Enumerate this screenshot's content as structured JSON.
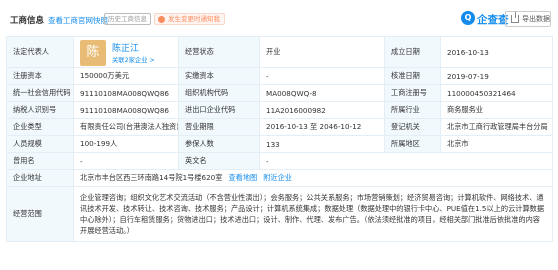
{
  "header": {
    "title": "工商信息",
    "official_link": "查看工商官网快照",
    "history_tag": "历史工商信息",
    "warning_tag": "发生变更时通知我",
    "brand": "企查查",
    "export_label": "导出数据",
    "colors": {
      "accent": "#128bed",
      "label_bg": "#f2f9fc",
      "avatar": "#e9bc75"
    }
  },
  "legal_rep": {
    "label": "法定代表人",
    "avatar_char": "陈",
    "name": "陈正江",
    "related": "关联2家企业 >"
  },
  "rows": {
    "status_label": "经营状态",
    "status_value": "开业",
    "est_label": "成立日期",
    "est_value": "2016-10-13",
    "capital_label": "注册资本",
    "capital_value": "150000万美元",
    "paid_label": "实缴资本",
    "paid_value": "-",
    "approve_label": "核准日期",
    "approve_value": "2019-07-19",
    "credit_label": "统一社会信用代码",
    "credit_value": "91110108MA008QWQ86",
    "org_label": "组织机构代码",
    "org_value": "MA008QWQ-8",
    "reg_label": "工商注册号",
    "reg_value": "110000450321464",
    "tax_label": "纳税人识别号",
    "tax_value": "91110108MA008QWQ86",
    "ie_label": "进出口企业代码",
    "ie_value": "11A2016000982",
    "industry_label": "所属行业",
    "industry_value": "商务服务业",
    "type_label": "企业类型",
    "type_value": "有限责任公司(台港澳法人独资)",
    "term_label": "营业期限",
    "term_value": "2016-10-13 至 2046-10-12",
    "authority_label": "登记机关",
    "authority_value": "北京市工商行政管理局丰台分局",
    "staff_label": "人员规模",
    "staff_value": "100-199人",
    "insured_label": "参保人数",
    "insured_value": "133",
    "region_label": "所属地区",
    "region_value": "北京市",
    "former_label": "曾用名",
    "former_value": "-",
    "en_label": "英文名",
    "en_value": "-",
    "address_label": "企业地址",
    "address_value": "北京市丰台区西三环南路14号院1号楼620室",
    "map_link": "查看地图",
    "nearby_link": "附近企业",
    "scope_label": "经营范围",
    "scope_value": "企业管理咨询；组织文化艺术交流活动（不含营业性演出）；会务服务；公共关系服务；市场营销策划；经济贸易咨询；计算机软件、网络技术、通讯技术开发、技术转让、技术咨询、技术服务；产品设计；计算机系统集成；数据处理（数据处理中的银行卡中心、PUE值在1.5以上的云计算数据中心除外）；自行车租赁服务；货物进出口；技术进出口；设计、制作、代理、发布广告。（依法须经批准的项目，经相关部门批准后依批准的内容开展经营活动。）"
  }
}
